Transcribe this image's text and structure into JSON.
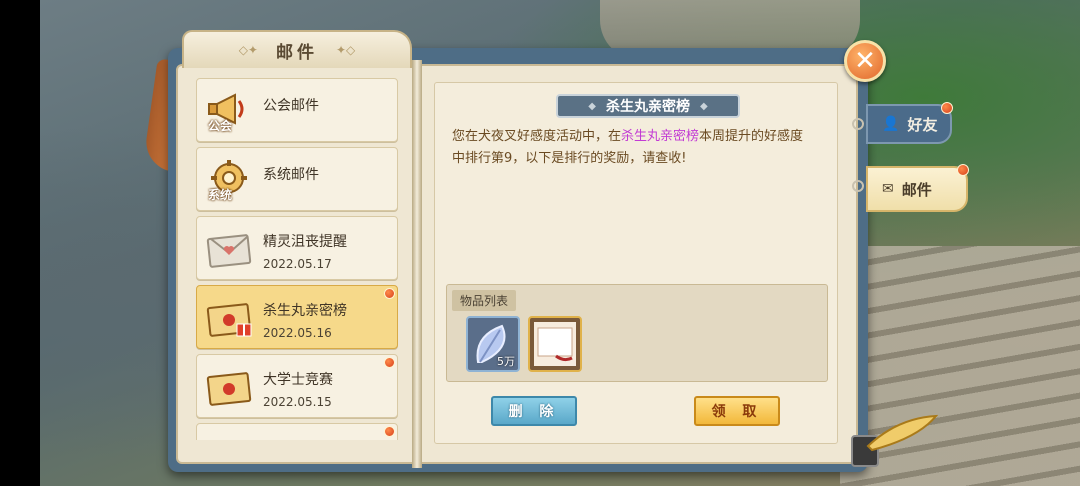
{
  "window": {
    "title": "邮件"
  },
  "mail_list": [
    {
      "label": "公会邮件",
      "icon": "megaphone-icon",
      "icon_text": "公会",
      "date": "",
      "selected": false,
      "unread": false
    },
    {
      "label": "系统邮件",
      "icon": "gear-icon",
      "icon_text": "系统",
      "date": "",
      "selected": false,
      "unread": false
    },
    {
      "label": "精灵沮丧提醒",
      "icon": "envelope-heart-icon",
      "date": "2022.05.17",
      "selected": false,
      "unread": false
    },
    {
      "label": "杀生丸亲密榜",
      "icon": "envelope-gift-icon",
      "date": "2022.05.16",
      "selected": true,
      "unread": true
    },
    {
      "label": "大学士竞赛",
      "icon": "envelope-seal-icon",
      "date": "2022.05.15",
      "selected": false,
      "unread": true
    }
  ],
  "message": {
    "title": "杀生丸亲密榜",
    "body_part1": "您在犬夜叉好感度活动中，在",
    "body_highlight": "杀生丸亲密榜",
    "body_part2": "本周提升的好感度中排行第9，以下是排行的奖励，请查收!",
    "highlight_color": "#c23bd4"
  },
  "items": {
    "label": "物品列表",
    "list": [
      {
        "icon": "feather-leaf-icon",
        "qty": "5万"
      },
      {
        "icon": "scroll-icon",
        "qty": ""
      }
    ]
  },
  "buttons": {
    "delete": "删 除",
    "claim": "领 取"
  },
  "side_tabs": {
    "friends": "好友",
    "mail": "邮件"
  },
  "colors": {
    "accent_orange": "#e0662a",
    "unread_dot": "#d6401c",
    "selected_item": "#f6d98a"
  }
}
